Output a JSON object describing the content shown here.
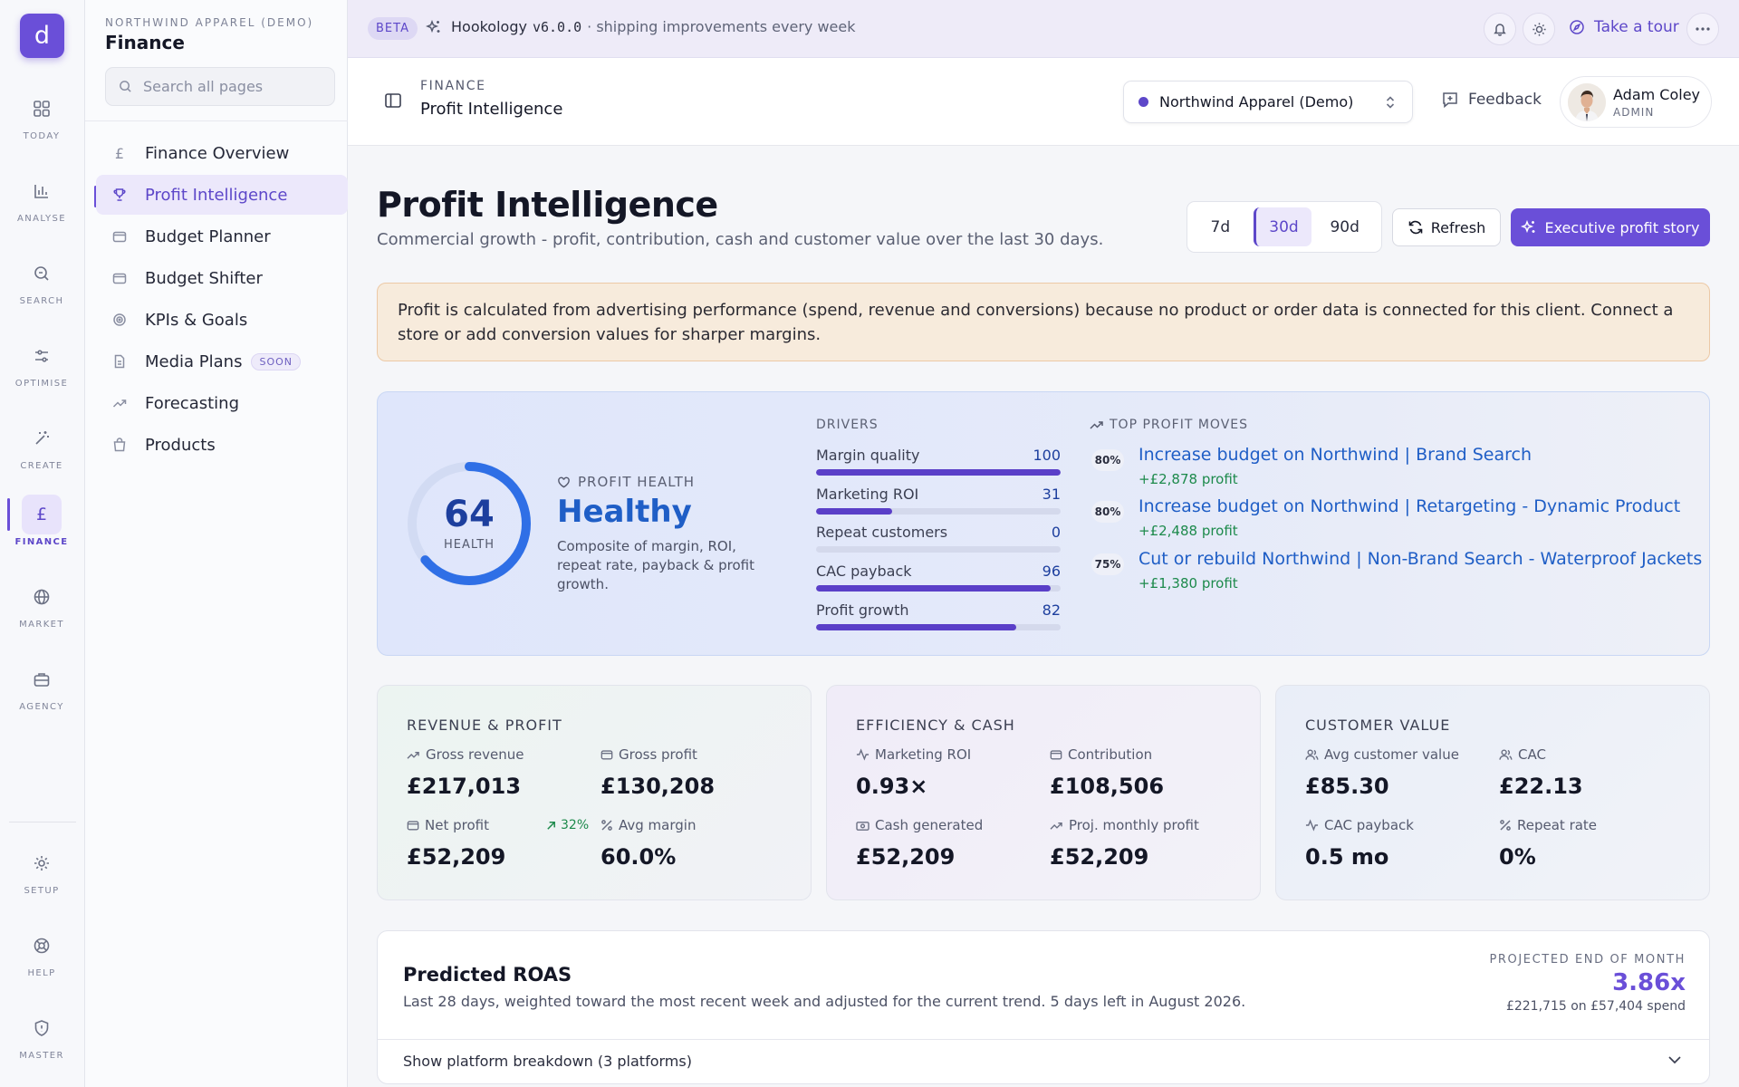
{
  "rail": {
    "logo": "d",
    "items": [
      {
        "label": "TODAY"
      },
      {
        "label": "ANALYSE"
      },
      {
        "label": "SEARCH"
      },
      {
        "label": "OPTIMISE"
      },
      {
        "label": "CREATE"
      },
      {
        "label": "FINANCE"
      },
      {
        "label": "MARKET"
      },
      {
        "label": "AGENCY"
      },
      {
        "label": "SETUP"
      },
      {
        "label": "HELP"
      },
      {
        "label": "MASTER"
      }
    ]
  },
  "sidebar": {
    "org": "NORTHWIND APPAREL (DEMO)",
    "workspace": "Finance",
    "search_placeholder": "Search all pages",
    "items": [
      {
        "label": "Finance Overview",
        "icon": "pound-icon"
      },
      {
        "label": "Profit Intelligence",
        "icon": "trophy-icon",
        "active": true
      },
      {
        "label": "Budget Planner",
        "icon": "wallet-icon"
      },
      {
        "label": "Budget Shifter",
        "icon": "wallet-icon"
      },
      {
        "label": "KPIs & Goals",
        "icon": "target-icon"
      },
      {
        "label": "Media Plans",
        "icon": "document-icon",
        "badge": "SOON"
      },
      {
        "label": "Forecasting",
        "icon": "trend-up-icon"
      },
      {
        "label": "Products",
        "icon": "bag-icon"
      }
    ]
  },
  "banner": {
    "badge": "BETA",
    "product": "Hookology",
    "version": "v6.0.0",
    "tagline": "· shipping improvements every week",
    "tour": "Take a tour"
  },
  "header": {
    "section": "FINANCE",
    "title": "Profit Intelligence",
    "client": "Northwind Apparel (Demo)",
    "feedback": "Feedback",
    "user_name": "Adam Coley",
    "user_role": "ADMIN"
  },
  "page": {
    "title": "Profit Intelligence",
    "subtitle": "Commercial growth - profit, contribution, cash and customer value over the last 30 days.",
    "ranges": [
      "7d",
      "30d",
      "90d"
    ],
    "selected_range": "30d",
    "refresh": "Refresh",
    "story": "Executive profit story"
  },
  "alert": "Profit is calculated from advertising performance (spend, revenue and conversions) because no product or order data is connected for this client. Connect a store or add conversion values for sharper margins.",
  "health": {
    "score": "64",
    "score_value": 64,
    "score_label": "HEALTH",
    "section_label": "PROFIT HEALTH",
    "status": "Healthy",
    "description": "Composite of margin, ROI, repeat rate, payback & profit growth.",
    "drivers_label": "DRIVERS",
    "drivers": [
      {
        "label": "Margin quality",
        "value": "100",
        "score": 100
      },
      {
        "label": "Marketing ROI",
        "value": "31",
        "score": 31
      },
      {
        "label": "Repeat customers",
        "value": "0",
        "score": 0
      },
      {
        "label": "CAC payback",
        "value": "96",
        "score": 96
      },
      {
        "label": "Profit growth",
        "value": "82",
        "score": 82
      }
    ],
    "moves_label": "TOP PROFIT MOVES",
    "moves": [
      {
        "confidence": "80%",
        "title": "Increase budget on Northwind | Brand Search",
        "profit": "+£2,878 profit"
      },
      {
        "confidence": "80%",
        "title": "Increase budget on Northwind | Retargeting - Dynamic Product",
        "profit": "+£2,488 profit"
      },
      {
        "confidence": "75%",
        "title": "Cut or rebuild Northwind | Non-Brand Search - Waterproof Jackets",
        "profit": "+£1,380 profit"
      }
    ]
  },
  "cards": [
    {
      "title": "REVENUE & PROFIT",
      "metrics": [
        {
          "label": "Gross revenue",
          "value": "£217,013",
          "icon": "trend-up-icon"
        },
        {
          "label": "Gross profit",
          "value": "£130,208",
          "icon": "wallet-icon"
        },
        {
          "label": "Net profit",
          "value": "£52,209",
          "icon": "wallet-icon"
        },
        {
          "label": "Avg margin",
          "value": "60.0%",
          "icon": "percent-icon"
        }
      ],
      "badge": "32%"
    },
    {
      "title": "EFFICIENCY & CASH",
      "metrics": [
        {
          "label": "Marketing ROI",
          "value": "0.93×",
          "icon": "pulse-icon"
        },
        {
          "label": "Contribution",
          "value": "£108,506",
          "icon": "wallet-icon"
        },
        {
          "label": "Cash generated",
          "value": "£52,209",
          "icon": "cash-icon"
        },
        {
          "label": "Proj. monthly profit",
          "value": "£52,209",
          "icon": "trend-up-icon"
        }
      ]
    },
    {
      "title": "CUSTOMER VALUE",
      "metrics": [
        {
          "label": "Avg customer value",
          "value": "£85.30",
          "icon": "users-icon"
        },
        {
          "label": "CAC",
          "value": "£22.13",
          "icon": "users-icon"
        },
        {
          "label": "CAC payback",
          "value": "0.5 mo",
          "icon": "pulse-icon"
        },
        {
          "label": "Repeat rate",
          "value": "0%",
          "icon": "percent-icon"
        }
      ]
    }
  ],
  "predicted": {
    "title": "Predicted ROAS",
    "subtitle": "Last 28 days, weighted toward the most recent week and adjusted for the current trend. 5 days left in August 2026.",
    "label": "PROJECTED END OF MONTH",
    "value": "3.86x",
    "note": "£221,715 on £57,404 spend",
    "breakdown": "Show platform breakdown (3 platforms)"
  },
  "colors": {
    "accent": "#6a4fd8",
    "link": "#1f5ec6",
    "positive": "#1d8a4c",
    "gauge": "#2f6fe6"
  }
}
